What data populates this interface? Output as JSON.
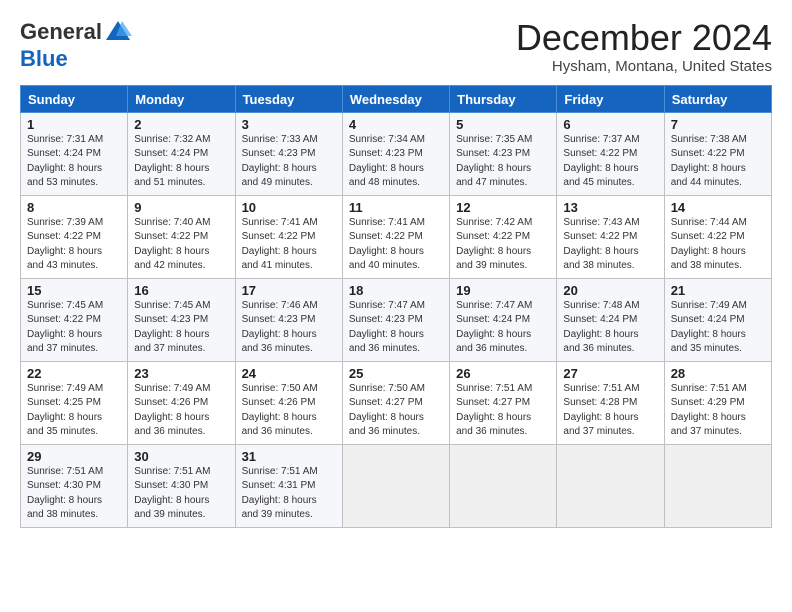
{
  "logo": {
    "general": "General",
    "blue": "Blue"
  },
  "title": "December 2024",
  "location": "Hysham, Montana, United States",
  "days_of_week": [
    "Sunday",
    "Monday",
    "Tuesday",
    "Wednesday",
    "Thursday",
    "Friday",
    "Saturday"
  ],
  "weeks": [
    [
      {
        "day": "1",
        "sunrise": "Sunrise: 7:31 AM",
        "sunset": "Sunset: 4:24 PM",
        "daylight": "Daylight: 8 hours and 53 minutes."
      },
      {
        "day": "2",
        "sunrise": "Sunrise: 7:32 AM",
        "sunset": "Sunset: 4:24 PM",
        "daylight": "Daylight: 8 hours and 51 minutes."
      },
      {
        "day": "3",
        "sunrise": "Sunrise: 7:33 AM",
        "sunset": "Sunset: 4:23 PM",
        "daylight": "Daylight: 8 hours and 49 minutes."
      },
      {
        "day": "4",
        "sunrise": "Sunrise: 7:34 AM",
        "sunset": "Sunset: 4:23 PM",
        "daylight": "Daylight: 8 hours and 48 minutes."
      },
      {
        "day": "5",
        "sunrise": "Sunrise: 7:35 AM",
        "sunset": "Sunset: 4:23 PM",
        "daylight": "Daylight: 8 hours and 47 minutes."
      },
      {
        "day": "6",
        "sunrise": "Sunrise: 7:37 AM",
        "sunset": "Sunset: 4:22 PM",
        "daylight": "Daylight: 8 hours and 45 minutes."
      },
      {
        "day": "7",
        "sunrise": "Sunrise: 7:38 AM",
        "sunset": "Sunset: 4:22 PM",
        "daylight": "Daylight: 8 hours and 44 minutes."
      }
    ],
    [
      {
        "day": "8",
        "sunrise": "Sunrise: 7:39 AM",
        "sunset": "Sunset: 4:22 PM",
        "daylight": "Daylight: 8 hours and 43 minutes."
      },
      {
        "day": "9",
        "sunrise": "Sunrise: 7:40 AM",
        "sunset": "Sunset: 4:22 PM",
        "daylight": "Daylight: 8 hours and 42 minutes."
      },
      {
        "day": "10",
        "sunrise": "Sunrise: 7:41 AM",
        "sunset": "Sunset: 4:22 PM",
        "daylight": "Daylight: 8 hours and 41 minutes."
      },
      {
        "day": "11",
        "sunrise": "Sunrise: 7:41 AM",
        "sunset": "Sunset: 4:22 PM",
        "daylight": "Daylight: 8 hours and 40 minutes."
      },
      {
        "day": "12",
        "sunrise": "Sunrise: 7:42 AM",
        "sunset": "Sunset: 4:22 PM",
        "daylight": "Daylight: 8 hours and 39 minutes."
      },
      {
        "day": "13",
        "sunrise": "Sunrise: 7:43 AM",
        "sunset": "Sunset: 4:22 PM",
        "daylight": "Daylight: 8 hours and 38 minutes."
      },
      {
        "day": "14",
        "sunrise": "Sunrise: 7:44 AM",
        "sunset": "Sunset: 4:22 PM",
        "daylight": "Daylight: 8 hours and 38 minutes."
      }
    ],
    [
      {
        "day": "15",
        "sunrise": "Sunrise: 7:45 AM",
        "sunset": "Sunset: 4:22 PM",
        "daylight": "Daylight: 8 hours and 37 minutes."
      },
      {
        "day": "16",
        "sunrise": "Sunrise: 7:45 AM",
        "sunset": "Sunset: 4:23 PM",
        "daylight": "Daylight: 8 hours and 37 minutes."
      },
      {
        "day": "17",
        "sunrise": "Sunrise: 7:46 AM",
        "sunset": "Sunset: 4:23 PM",
        "daylight": "Daylight: 8 hours and 36 minutes."
      },
      {
        "day": "18",
        "sunrise": "Sunrise: 7:47 AM",
        "sunset": "Sunset: 4:23 PM",
        "daylight": "Daylight: 8 hours and 36 minutes."
      },
      {
        "day": "19",
        "sunrise": "Sunrise: 7:47 AM",
        "sunset": "Sunset: 4:24 PM",
        "daylight": "Daylight: 8 hours and 36 minutes."
      },
      {
        "day": "20",
        "sunrise": "Sunrise: 7:48 AM",
        "sunset": "Sunset: 4:24 PM",
        "daylight": "Daylight: 8 hours and 36 minutes."
      },
      {
        "day": "21",
        "sunrise": "Sunrise: 7:49 AM",
        "sunset": "Sunset: 4:24 PM",
        "daylight": "Daylight: 8 hours and 35 minutes."
      }
    ],
    [
      {
        "day": "22",
        "sunrise": "Sunrise: 7:49 AM",
        "sunset": "Sunset: 4:25 PM",
        "daylight": "Daylight: 8 hours and 35 minutes."
      },
      {
        "day": "23",
        "sunrise": "Sunrise: 7:49 AM",
        "sunset": "Sunset: 4:26 PM",
        "daylight": "Daylight: 8 hours and 36 minutes."
      },
      {
        "day": "24",
        "sunrise": "Sunrise: 7:50 AM",
        "sunset": "Sunset: 4:26 PM",
        "daylight": "Daylight: 8 hours and 36 minutes."
      },
      {
        "day": "25",
        "sunrise": "Sunrise: 7:50 AM",
        "sunset": "Sunset: 4:27 PM",
        "daylight": "Daylight: 8 hours and 36 minutes."
      },
      {
        "day": "26",
        "sunrise": "Sunrise: 7:51 AM",
        "sunset": "Sunset: 4:27 PM",
        "daylight": "Daylight: 8 hours and 36 minutes."
      },
      {
        "day": "27",
        "sunrise": "Sunrise: 7:51 AM",
        "sunset": "Sunset: 4:28 PM",
        "daylight": "Daylight: 8 hours and 37 minutes."
      },
      {
        "day": "28",
        "sunrise": "Sunrise: 7:51 AM",
        "sunset": "Sunset: 4:29 PM",
        "daylight": "Daylight: 8 hours and 37 minutes."
      }
    ],
    [
      {
        "day": "29",
        "sunrise": "Sunrise: 7:51 AM",
        "sunset": "Sunset: 4:30 PM",
        "daylight": "Daylight: 8 hours and 38 minutes."
      },
      {
        "day": "30",
        "sunrise": "Sunrise: 7:51 AM",
        "sunset": "Sunset: 4:30 PM",
        "daylight": "Daylight: 8 hours and 39 minutes."
      },
      {
        "day": "31",
        "sunrise": "Sunrise: 7:51 AM",
        "sunset": "Sunset: 4:31 PM",
        "daylight": "Daylight: 8 hours and 39 minutes."
      },
      null,
      null,
      null,
      null
    ]
  ]
}
